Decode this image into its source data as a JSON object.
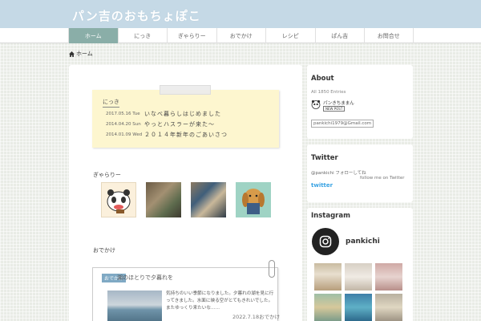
{
  "site": {
    "title": "パン吉のおもちょぽこ"
  },
  "nav": [
    {
      "label": "ホーム"
    },
    {
      "label": "にっき"
    },
    {
      "label": "ぎゃらりー"
    },
    {
      "label": "おでかけ"
    },
    {
      "label": "レシピ"
    },
    {
      "label": "ぱん吉"
    },
    {
      "label": "お問合せ"
    }
  ],
  "breadcrumb": {
    "label": "ホーム"
  },
  "diary": {
    "title": "にっき",
    "entries": [
      {
        "date": "2017.05.16 Tue",
        "text": "いなべ暮らしはじめました"
      },
      {
        "date": "2014.04.20 Sun",
        "text": "やっとハスラーが来た～"
      },
      {
        "date": "2014.01.09 Wed",
        "text": "２０１４年新年のごあいさつ"
      }
    ]
  },
  "gallery": {
    "title": "ぎゃらりー"
  },
  "outing": {
    "title": "おでかけ",
    "card": {
      "category": "おでかけ",
      "title": "湖のほとりで夕暮れを",
      "excerpt": "気持ちのいい季節になりました。夕暮れの湖を見に行ってきました。水面に映る空がとてもきれいでした。またゆっくり来たいな……",
      "date": "2022.7.18",
      "date_suffix": "おでかけ"
    }
  },
  "sidebar": {
    "about": {
      "title": "About",
      "entries": "All 1850 Entries",
      "profile_name": "パンきちままん",
      "badge": "NEW POST",
      "email": "pankichi1979@Gmail.com"
    },
    "twitter": {
      "title": "Twitter",
      "handle": "@pankichi フォローしてね",
      "follow": "follow me on Twitter",
      "logo": "twitter"
    },
    "instagram": {
      "title": "Instagram",
      "username": "pankichi"
    }
  },
  "colors": {
    "header": "#c5d9e6",
    "nav_active": "#8aaea8",
    "category": "#7fa9c4",
    "note": "#fdf6cf"
  }
}
